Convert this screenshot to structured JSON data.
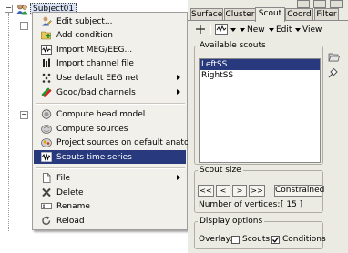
{
  "tree": {
    "subject_label": "Subject01",
    "expander_symbols": [
      "−",
      "−",
      "−"
    ]
  },
  "menu": {
    "items": [
      {
        "label": "Edit subject...",
        "icon": "edit-subject-icon",
        "submenu": false
      },
      {
        "label": "Add condition",
        "icon": "add-condition-icon",
        "submenu": false
      },
      {
        "label": "Import MEG/EEG...",
        "icon": "import-meg-icon",
        "submenu": false
      },
      {
        "label": "Import channel file",
        "icon": "import-channel-icon",
        "submenu": false
      },
      {
        "label": "Use default EEG net",
        "icon": "eeg-net-icon",
        "submenu": true
      },
      {
        "label": "Good/bad channels",
        "icon": "good-bad-icon",
        "submenu": true
      },
      {
        "label": "Compute head model",
        "icon": "head-model-icon",
        "submenu": false
      },
      {
        "label": "Compute sources",
        "icon": "compute-sources-icon",
        "submenu": false
      },
      {
        "label": "Project sources on default anatomy",
        "icon": "project-sources-icon",
        "submenu": false
      },
      {
        "label": "Scouts time series",
        "icon": "scouts-time-series-icon",
        "submenu": false,
        "selected": true
      },
      {
        "label": "File",
        "icon": "file-icon",
        "submenu": true
      },
      {
        "label": "Delete",
        "icon": "delete-icon",
        "submenu": false
      },
      {
        "label": "Rename",
        "icon": "rename-icon",
        "submenu": false
      },
      {
        "label": "Reload",
        "icon": "reload-icon",
        "submenu": false
      }
    ]
  },
  "panel": {
    "tabs": [
      "Surface",
      "Cluster",
      "Scout",
      "Coord",
      "Filter"
    ],
    "active_tab": "Scout",
    "toolbar": {
      "new_label": "New",
      "edit_label": "Edit",
      "view_label": "View"
    },
    "available_scouts": {
      "legend": "Available scouts",
      "items": [
        "LeftSS",
        "RightSS"
      ],
      "selected": "LeftSS"
    },
    "scout_size": {
      "legend": "Scout size",
      "buttons": [
        "<<",
        "<",
        ">",
        ">>"
      ],
      "constrained_label": "Constrained",
      "vertices_label": "Number of vertices:",
      "vertices_value": "[ 15 ]"
    },
    "display_options": {
      "legend": "Display options",
      "overlay_label": "Overlay:",
      "scouts_label": "Scouts",
      "scouts_checked": false,
      "conditions_label": "Conditions",
      "conditions_checked": true
    }
  },
  "colors": {
    "selection": "#283a7d",
    "menu_bg": "#f1f0ea",
    "panel_bg": "#ecebe3"
  }
}
